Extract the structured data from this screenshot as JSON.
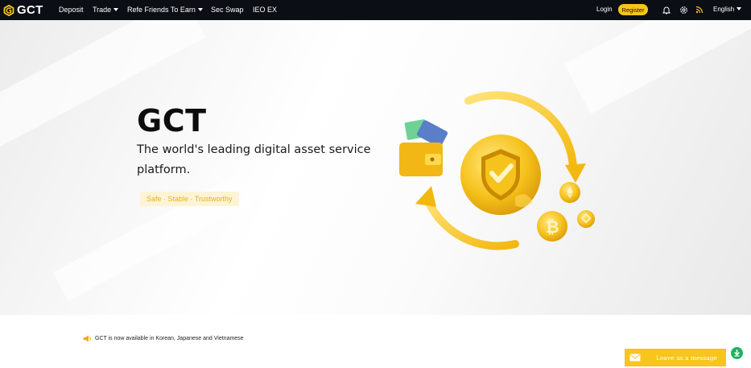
{
  "nav": {
    "logo_text": "GCT",
    "items": [
      {
        "label": "Deposit"
      },
      {
        "label": "Trade"
      },
      {
        "label": "Refe Friends To Earn"
      },
      {
        "label": "Sec Swap"
      },
      {
        "label": "IEO EX"
      }
    ],
    "login_label": "Login",
    "register_label": "Register",
    "language_label": "English",
    "icons": [
      "bell-icon",
      "settings-icon",
      "rss-icon",
      "chevron-down-icon"
    ]
  },
  "hero": {
    "title": "GCT",
    "subtitle": "The world's leading digital asset service platform.",
    "tagline": "Safe · Stable · Trustworthy"
  },
  "notice": {
    "text": "GCT is now available in Korean, Japanese and Vietnamese"
  },
  "message_widget": {
    "label": "Leave us a message"
  },
  "colors": {
    "accent": "#f7c51b",
    "nav_bg": "#0b0e14",
    "tagline_bg": "#fdf4d6",
    "tagline_text": "#e5b11c",
    "download_green": "#1eb25f"
  }
}
